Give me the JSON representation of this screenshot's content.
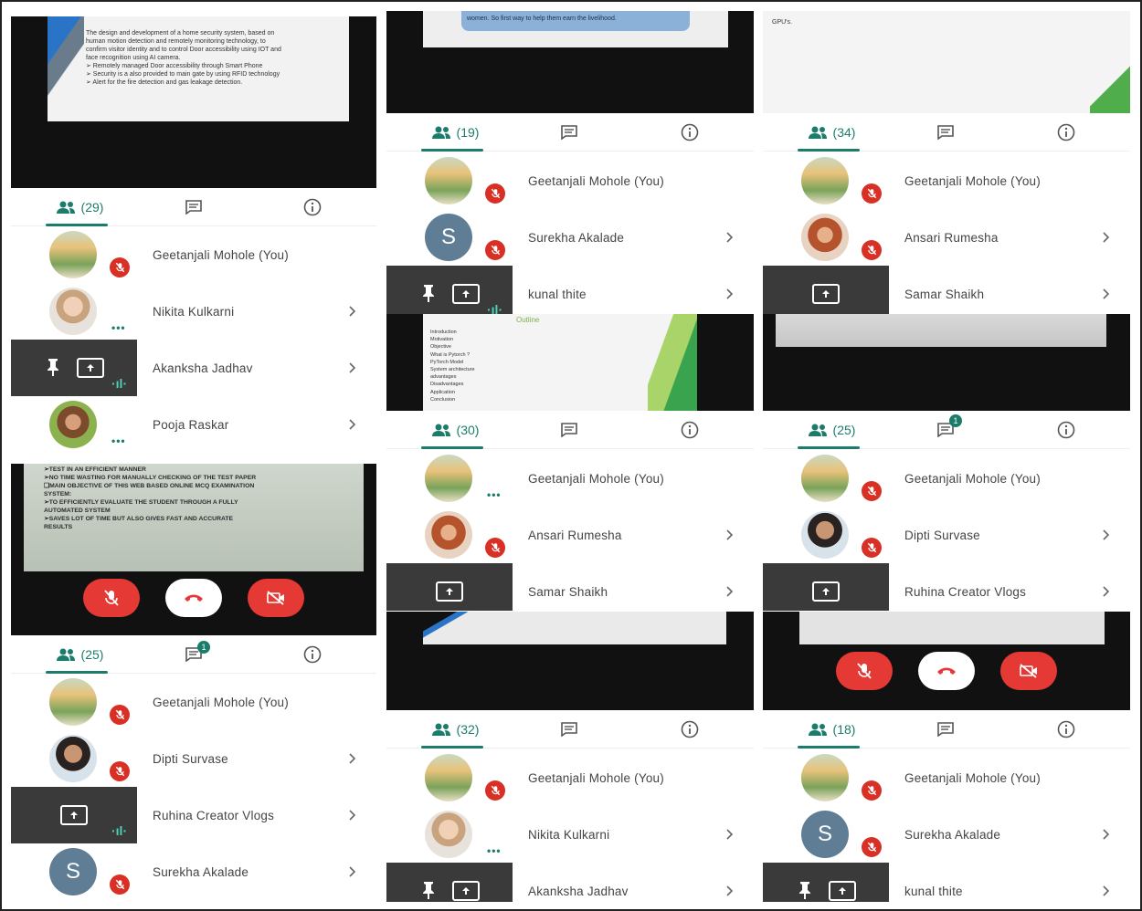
{
  "panels": [
    {
      "count": "(29)",
      "chat_badge": "",
      "participants": [
        {
          "name": "Geetanjali Mohole (You)",
          "avatar": "logo",
          "status": "muted",
          "thumb": "light",
          "chevron": false
        },
        {
          "name": "Nikita Kulkarni",
          "avatar": "photo1",
          "status": "dots",
          "thumb": "light",
          "chevron": true
        },
        {
          "name": "Akanksha Jadhav",
          "avatar": "",
          "status": "wave",
          "thumb": "dark-pin",
          "chevron": true
        },
        {
          "name": "Pooja Raskar",
          "avatar": "photo4",
          "status": "dots",
          "thumb": "light",
          "chevron": true
        }
      ],
      "slide_lines": [
        "The design and development of a home security system, based on",
        "human motion detection and remotely monitoring technology, to",
        "confirm visitor identity and to control Door accessibility using IOT and",
        "face recognition using AI camera.",
        "➢ Remotely managed Door accessibility through Smart Phone",
        "➢ Security is a also provided to main gate by using RFID technology",
        "➢ Alert for the fire detection and gas leakage detection."
      ]
    },
    {
      "count": "(19)",
      "chat_badge": "",
      "participants": [
        {
          "name": "Geetanjali Mohole (You)",
          "avatar": "logo",
          "status": "muted",
          "thumb": "light",
          "chevron": false
        },
        {
          "name": "Surekha Akalade",
          "avatar": "letter",
          "letter": "S",
          "status": "muted",
          "thumb": "light",
          "chevron": true
        },
        {
          "name": "kunal thite",
          "avatar": "",
          "status": "wave",
          "thumb": "dark-pin",
          "chevron": true
        }
      ],
      "slide_lines": [
        "women. So first way to help them earn the livelihood."
      ]
    },
    {
      "count": "(34)",
      "chat_badge": "",
      "participants": [
        {
          "name": "Geetanjali Mohole (You)",
          "avatar": "logo",
          "status": "muted",
          "thumb": "light",
          "chevron": false
        },
        {
          "name": "Ansari Rumesha",
          "avatar": "photo2",
          "status": "muted",
          "thumb": "light",
          "chevron": true
        },
        {
          "name": "Samar Shaikh",
          "avatar": "",
          "status": "",
          "thumb": "dark",
          "chevron": true
        }
      ],
      "slide_lines": [
        "GPU's."
      ]
    },
    {
      "count": "(30)",
      "chat_badge": "",
      "participants": [
        {
          "name": "Geetanjali Mohole (You)",
          "avatar": "logo",
          "status": "dots",
          "thumb": "light",
          "chevron": false
        },
        {
          "name": "Ansari Rumesha",
          "avatar": "photo2",
          "status": "muted",
          "thumb": "light",
          "chevron": true
        },
        {
          "name": "Samar Shaikh",
          "avatar": "",
          "status": "",
          "thumb": "dark",
          "chevron": true
        }
      ],
      "slide_title": "Outline",
      "slide_lines": [
        "Introduction",
        "Motivation",
        "Objective",
        "What is Pytorch ?",
        "PyTorch Model",
        "System architecture",
        "advantages",
        "Disadvantages",
        "Application",
        "Conclusion"
      ]
    },
    {
      "count": "(25)",
      "chat_badge": "1",
      "participants": [
        {
          "name": "Geetanjali Mohole (You)",
          "avatar": "logo",
          "status": "muted",
          "thumb": "light",
          "chevron": false
        },
        {
          "name": "Dipti Survase",
          "avatar": "photo3",
          "status": "muted",
          "thumb": "light",
          "chevron": true
        },
        {
          "name": "Ruhina Creator Vlogs",
          "avatar": "",
          "status": "",
          "thumb": "dark",
          "chevron": true
        }
      ]
    },
    {
      "count": "(25)",
      "chat_badge": "1",
      "participants": [
        {
          "name": "Geetanjali Mohole (You)",
          "avatar": "logo",
          "status": "muted",
          "thumb": "light",
          "chevron": false
        },
        {
          "name": "Dipti Survase",
          "avatar": "photo3",
          "status": "muted",
          "thumb": "light",
          "chevron": true
        },
        {
          "name": "Ruhina Creator Vlogs",
          "avatar": "",
          "status": "wave",
          "thumb": "dark",
          "chevron": true
        },
        {
          "name": "Surekha Akalade",
          "avatar": "letter",
          "letter": "S",
          "status": "muted",
          "thumb": "light",
          "chevron": true
        }
      ],
      "slide_lines": [
        "➢TEST IN AN EFFICIENT MANNER",
        "➢NO TIME WASTING FOR MANUALLY CHECKING OF THE TEST PAPER",
        "❑MAIN OBJECTIVE OF THIS WEB BASED ONLINE MCQ EXAMINATION",
        "SYSTEM:",
        "➢TO EFFICIENTLY EVALUATE THE STUDENT THROUGH A FULLY",
        "AUTOMATED SYSTEM",
        "➢SAVES LOT OF TIME BUT ALSO GIVES FAST AND ACCURATE",
        "RESULTS"
      ]
    },
    {
      "count": "(32)",
      "chat_badge": "",
      "participants": [
        {
          "name": "Geetanjali Mohole (You)",
          "avatar": "logo",
          "status": "muted",
          "thumb": "light",
          "chevron": false
        },
        {
          "name": "Nikita Kulkarni",
          "avatar": "photo1",
          "status": "dots",
          "thumb": "light",
          "chevron": true
        },
        {
          "name": "Akanksha Jadhav",
          "avatar": "",
          "status": "",
          "thumb": "dark-pin",
          "chevron": true
        }
      ]
    },
    {
      "count": "(18)",
      "chat_badge": "",
      "participants": [
        {
          "name": "Geetanjali Mohole (You)",
          "avatar": "logo",
          "status": "muted",
          "thumb": "light",
          "chevron": false
        },
        {
          "name": "Surekha Akalade",
          "avatar": "letter",
          "letter": "S",
          "status": "muted",
          "thumb": "light",
          "chevron": true
        },
        {
          "name": "kunal thite",
          "avatar": "",
          "status": "",
          "thumb": "dark-pin",
          "chevron": true
        }
      ]
    }
  ],
  "colors": {
    "accent": "#1b7c6b",
    "mute": "#d93025",
    "end_call": "#e53935"
  }
}
